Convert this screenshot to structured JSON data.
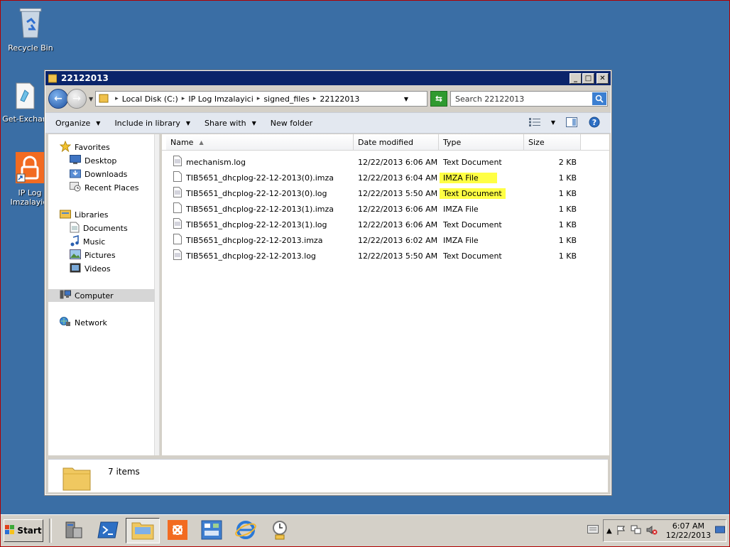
{
  "desktop": {
    "icons": [
      {
        "label": "Recycle Bin"
      },
      {
        "label": "Get-Exchan"
      },
      {
        "label": "IP Log Imzalayici"
      }
    ]
  },
  "window": {
    "title": "22122013",
    "breadcrumbs": [
      "Local Disk (C:)",
      "IP Log Imzalayici",
      "signed_files",
      "22122013"
    ],
    "search_placeholder": "Search 22122013",
    "toolbar": {
      "organize": "Organize",
      "include": "Include in library",
      "share": "Share with",
      "new_folder": "New folder"
    },
    "nav": {
      "favorites": "Favorites",
      "desktop": "Desktop",
      "downloads": "Downloads",
      "recent": "Recent Places",
      "libraries": "Libraries",
      "documents": "Documents",
      "music": "Music",
      "pictures": "Pictures",
      "videos": "Videos",
      "computer": "Computer",
      "network": "Network"
    },
    "columns": {
      "name": "Name",
      "date": "Date modified",
      "type": "Type",
      "size": "Size"
    },
    "files": [
      {
        "name": "mechanism.log",
        "date": "12/22/2013 6:06 AM",
        "type": "Text Document",
        "size": "2 KB",
        "highlight": false
      },
      {
        "name": "TIB5651_dhcplog-22-12-2013(0).imza",
        "date": "12/22/2013 6:04 AM",
        "type": "IMZA File",
        "size": "1 KB",
        "highlight": true
      },
      {
        "name": "TIB5651_dhcplog-22-12-2013(0).log",
        "date": "12/22/2013 5:50 AM",
        "type": "Text Document",
        "size": "1 KB",
        "highlight": true
      },
      {
        "name": "TIB5651_dhcplog-22-12-2013(1).imza",
        "date": "12/22/2013 6:06 AM",
        "type": "IMZA File",
        "size": "1 KB",
        "highlight": false
      },
      {
        "name": "TIB5651_dhcplog-22-12-2013(1).log",
        "date": "12/22/2013 6:06 AM",
        "type": "Text Document",
        "size": "1 KB",
        "highlight": false
      },
      {
        "name": "TIB5651_dhcplog-22-12-2013.imza",
        "date": "12/22/2013 6:02 AM",
        "type": "IMZA File",
        "size": "1 KB",
        "highlight": false
      },
      {
        "name": "TIB5651_dhcplog-22-12-2013.log",
        "date": "12/22/2013 5:50 AM",
        "type": "Text Document",
        "size": "1 KB",
        "highlight": false
      }
    ],
    "status": "7 items"
  },
  "taskbar": {
    "start": "Start",
    "time": "6:07 AM",
    "date": "12/22/2013"
  },
  "colors": {
    "desktop": "#3a6ea5",
    "titlebar": "#0a246a",
    "highlight": "#ffff44"
  }
}
